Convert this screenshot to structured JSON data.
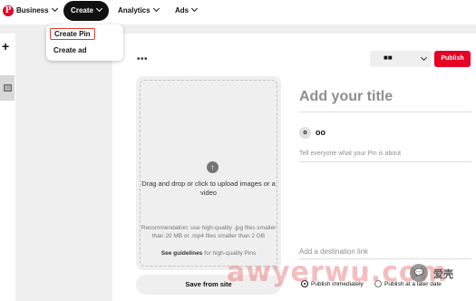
{
  "header": {
    "logo": "P",
    "business_label": "Business",
    "create_label": "Create",
    "analytics_label": "Analytics",
    "ads_label": "Ads"
  },
  "create_menu": {
    "items": [
      {
        "label": "Create Pin"
      },
      {
        "label": "Create ad"
      }
    ]
  },
  "sidebar": {
    "add_symbol": "+"
  },
  "toolbar": {
    "more_symbol": "•••",
    "board_value": "■■",
    "publish_label": "Publish"
  },
  "upload": {
    "instruction": "Drag and drop or click to upload images or a video",
    "recommendation": "Recommendation: use high-quality .jpg files smaller than 20 MB or .mp4 files smaller than 2 GB",
    "guidelines_link": "See guidelines",
    "guidelines_suffix": " for high-quality Pins",
    "save_from_site": "Save from site"
  },
  "form": {
    "title_placeholder": "Add your title",
    "avatar_initial": "o",
    "username": "oo",
    "about_placeholder": "Tell everyone what your Pin is about",
    "destination_placeholder": "Add a destination link",
    "publish_immediately": "Publish immediately",
    "publish_later": "Publish at a later date"
  },
  "watermark": {
    "text": "awyerwu.com",
    "badge": "💬",
    "brand": "爱壳"
  },
  "colors": {
    "brand_red": "#e60023",
    "highlight_border": "#e23b2e"
  }
}
